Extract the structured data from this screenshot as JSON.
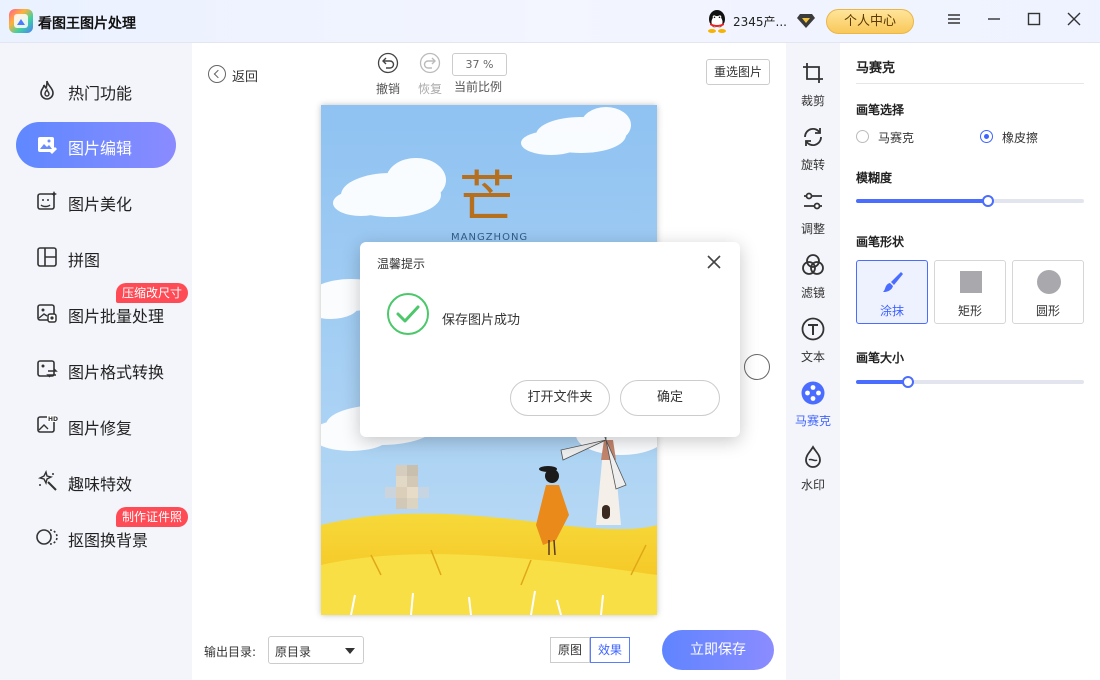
{
  "app": {
    "title": "看图王图片处理",
    "user_name": "2345产...",
    "personal_center": "个人中心"
  },
  "window_controls": [
    "menu-icon",
    "minimize-icon",
    "maximize-icon",
    "close-icon"
  ],
  "sidebar": {
    "active_index": 1,
    "items": [
      {
        "label": "热门功能",
        "icon": "flame-icon"
      },
      {
        "label": "图片编辑",
        "icon": "image-edit-icon"
      },
      {
        "label": "图片美化",
        "icon": "image-beautify-icon"
      },
      {
        "label": "拼图",
        "icon": "collage-icon"
      },
      {
        "label": "图片批量处理",
        "icon": "batch-process-icon",
        "badge": "压缩改尺寸"
      },
      {
        "label": "图片格式转换",
        "icon": "format-convert-icon"
      },
      {
        "label": "图片修复",
        "icon": "hd-repair-icon"
      },
      {
        "label": "趣味特效",
        "icon": "magic-wand-icon"
      },
      {
        "label": "抠图换背景",
        "icon": "cutout-icon",
        "badge": "制作证件照"
      }
    ]
  },
  "canvas": {
    "back": "返回",
    "undo": "撤销",
    "redo": "恢复",
    "zoom": "37 %",
    "zoom_label": "当前比例",
    "reselect": "重选图片",
    "image": {
      "title_char": "芒",
      "subtitle": "MANGZHONG"
    },
    "output_label": "输出目录:",
    "output_value": "原目录",
    "view_original": "原图",
    "view_effect": "效果",
    "save": "立即保存"
  },
  "dialog": {
    "title": "温馨提示",
    "message": "保存图片成功",
    "open_folder": "打开文件夹",
    "ok": "确定"
  },
  "tools": {
    "active_index": 5,
    "items": [
      {
        "label": "裁剪",
        "icon": "crop-icon"
      },
      {
        "label": "旋转",
        "icon": "rotate-icon"
      },
      {
        "label": "调整",
        "icon": "adjust-icon"
      },
      {
        "label": "滤镜",
        "icon": "filter-icon"
      },
      {
        "label": "文本",
        "icon": "text-icon"
      },
      {
        "label": "马赛克",
        "icon": "mosaic-icon"
      },
      {
        "label": "水印",
        "icon": "watermark-icon"
      }
    ]
  },
  "panel": {
    "title": "马赛克",
    "brush_select_title": "画笔选择",
    "brush_options": [
      {
        "label": "马赛克",
        "checked": false
      },
      {
        "label": "橡皮擦",
        "checked": true
      }
    ],
    "blur_title": "模糊度",
    "blur_value": 0.58,
    "shape_title": "画笔形状",
    "shapes": [
      {
        "label": "涂抹",
        "icon": "brush-icon",
        "selected": true
      },
      {
        "label": "矩形",
        "icon": "square-icon",
        "selected": false
      },
      {
        "label": "圆形",
        "icon": "circle-icon",
        "selected": false
      }
    ],
    "size_title": "画笔大小",
    "size_value": 0.23
  },
  "colors": {
    "accent": "#4b6dff",
    "badge": "#ff4b55",
    "success": "#4cc76a",
    "sky": "#8dbff0",
    "field": "#f6cc2a"
  }
}
